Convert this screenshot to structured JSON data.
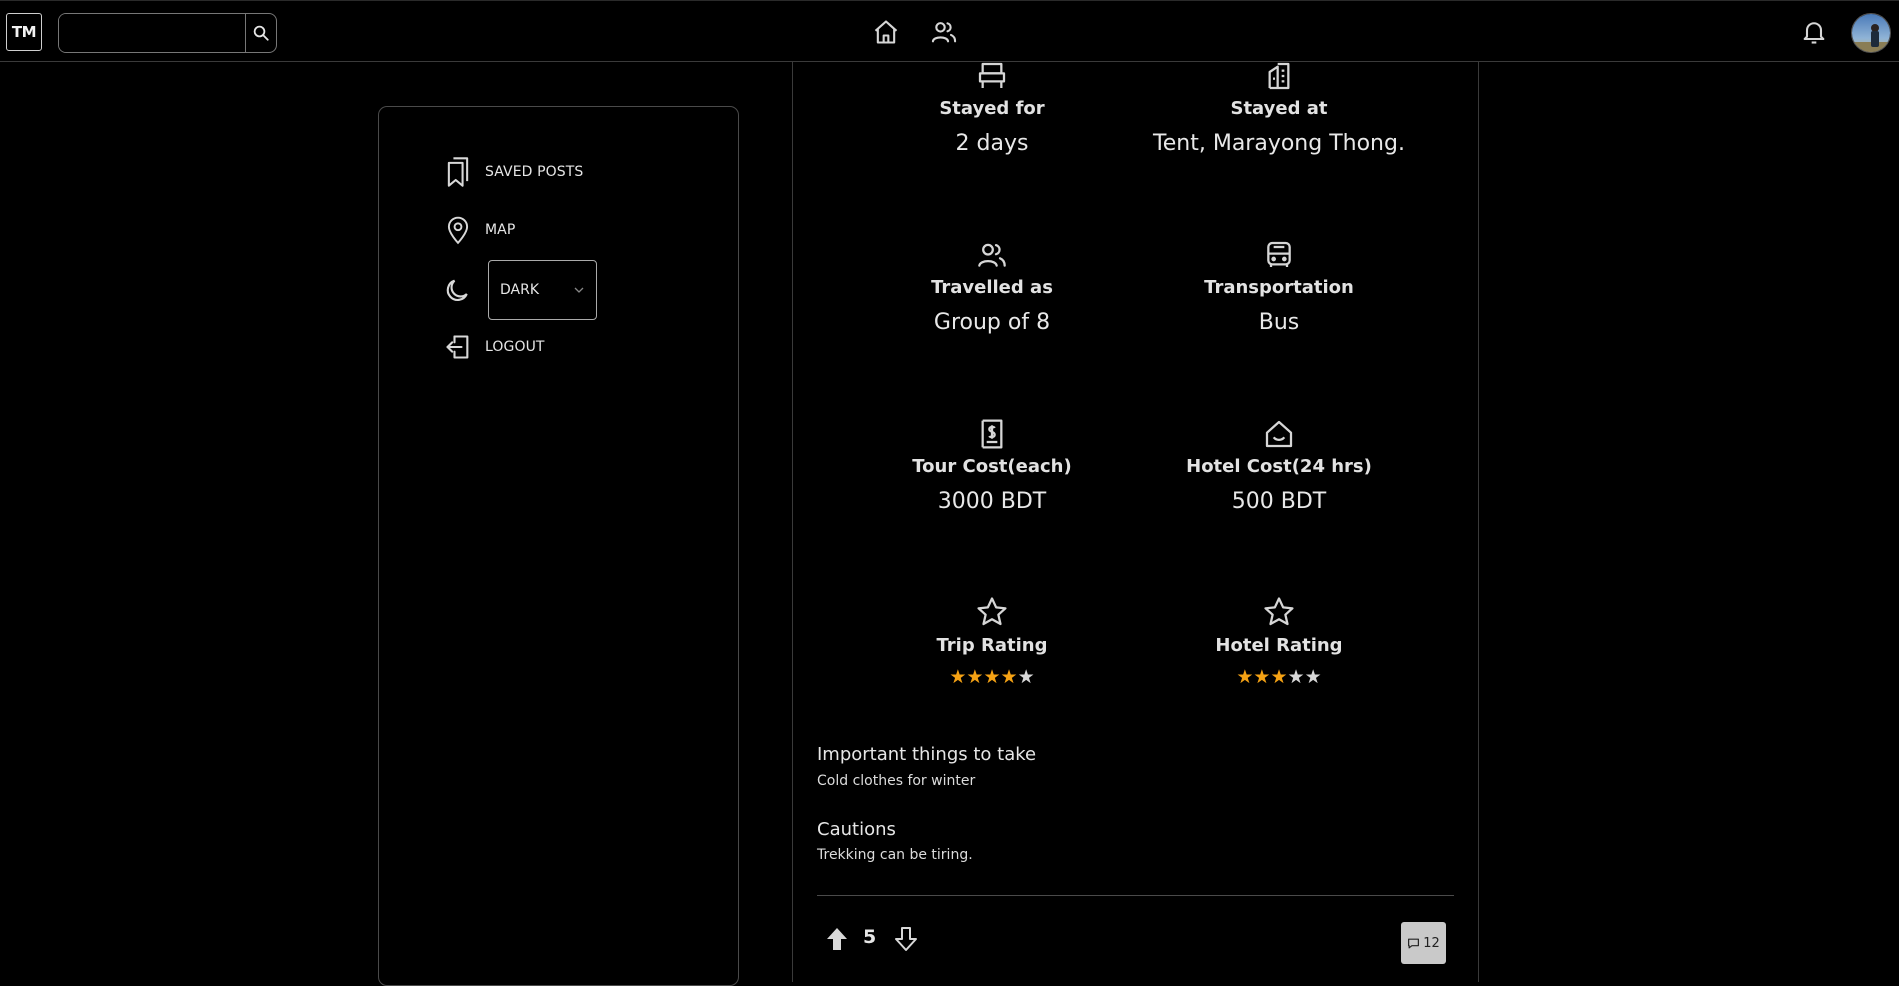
{
  "header": {
    "logo_text": "TM",
    "search": {
      "placeholder": "",
      "value": ""
    },
    "icons": [
      "search-icon",
      "home-icon",
      "people-icon",
      "bell-icon"
    ]
  },
  "sidebar": {
    "items": [
      {
        "label": "SAVED POSTS",
        "icon": "bookmark-icon"
      },
      {
        "label": "MAP",
        "icon": "map-pin-icon"
      },
      {
        "label": "LOGOUT",
        "icon": "logout-icon"
      }
    ],
    "theme": {
      "icon": "moon-icon",
      "selected": "DARK"
    }
  },
  "post": {
    "stats": [
      {
        "label": "Stayed for",
        "value": "2 days",
        "icon": "bed-icon"
      },
      {
        "label": "Stayed at",
        "value": "Tent, Marayong Thong.",
        "icon": "building-icon"
      },
      {
        "label": "Travelled as",
        "value": "Group of 8",
        "icon": "people-icon"
      },
      {
        "label": "Transportation",
        "value": "Bus",
        "icon": "bus-icon"
      },
      {
        "label": "Tour Cost(each)",
        "value": "3000 BDT",
        "icon": "receipt-icon"
      },
      {
        "label": "Hotel Cost(24 hrs)",
        "value": "500 BDT",
        "icon": "house-icon"
      }
    ],
    "ratings": [
      {
        "label": "Trip Rating",
        "rating": 4,
        "max": 5,
        "icon": "star-outline-icon"
      },
      {
        "label": "Hotel Rating",
        "rating": 3,
        "max": 5,
        "icon": "star-outline-icon"
      }
    ],
    "important": {
      "title": "Important things to take",
      "text": "Cold clothes for winter"
    },
    "cautions": {
      "title": "Cautions",
      "text": "Trekking can be tiring."
    },
    "votes": "5",
    "comments": "12"
  },
  "colors": {
    "background": "#000000",
    "star_filled": "#f5a214",
    "star_empty": "#d7d7d7",
    "comment_button": "#c9c9c9"
  }
}
